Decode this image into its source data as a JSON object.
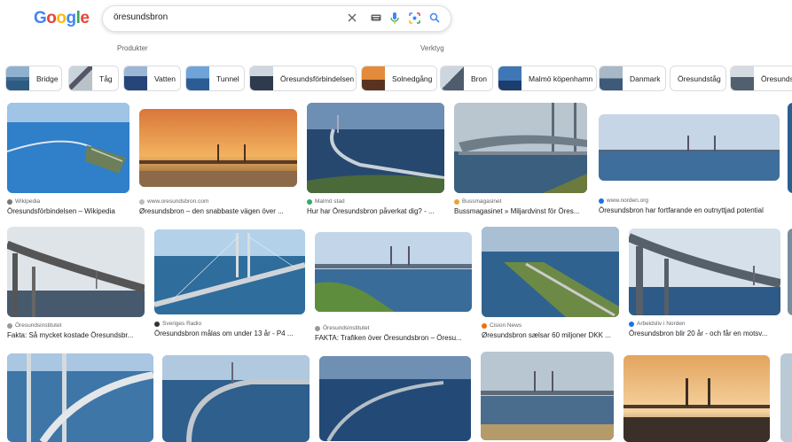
{
  "logo": {
    "letters": [
      "G",
      "o",
      "o",
      "g",
      "l",
      "e"
    ],
    "colors": [
      "#4285F4",
      "#EA4335",
      "#FBBC05",
      "#4285F4",
      "#34A853",
      "#EA4335"
    ]
  },
  "search": {
    "query": "öresundsbron",
    "icons": [
      "close-icon",
      "keyboard-icon",
      "mic-icon",
      "lens-icon",
      "search-icon"
    ]
  },
  "tools": {
    "produkter": "Produkter",
    "verktyg": "Verktyg"
  },
  "chips": [
    "Bridge",
    "Tåg",
    "Vatten",
    "Tunnel",
    "Öresundsförbindelsen",
    "Solnedgång",
    "Bron",
    "Malmö köpenhamn",
    "Danmark",
    "Öresundståg",
    "Öresunds"
  ],
  "results": [
    {
      "source": "Wikipedia",
      "title": "Öresundsförbindelsen – Wikipedia"
    },
    {
      "source": "www.oresundsbron.com",
      "title": "Øresundsbron – den snabbaste vägen över ..."
    },
    {
      "source": "Malmö stad",
      "title": "Hur har Öresundsbron påverkat dig? - ..."
    },
    {
      "source": "Bussmagasinet",
      "title": "Bussmagasinet » Miljardvinst för Öres..."
    },
    {
      "source": "www.norden.org",
      "title": "Öresundsbron har fortfarande en outnyttjad potential"
    },
    {
      "source": "Öresundsinstitutet",
      "title": "Fakta: Så mycket kostade Öresundsbr..."
    },
    {
      "source": "Sveriges Radio",
      "title": "Öresundsbron målas om under 13 år - P4 ..."
    },
    {
      "source": "Öresundsinstitutet",
      "title": "FAKTA: Trafiken över Öresundsbron – Öresu..."
    },
    {
      "source": "Cision News",
      "title": "Øresundsbron sælsar 60 miljoner DKK ..."
    },
    {
      "source": "Arbeidsliv i Norden",
      "title": "Öresundsbron blir 20 år - och får en motsv..."
    }
  ],
  "colors": {
    "accent": "#1a73e8",
    "border": "#dadce0",
    "muted": "#5f6368"
  }
}
